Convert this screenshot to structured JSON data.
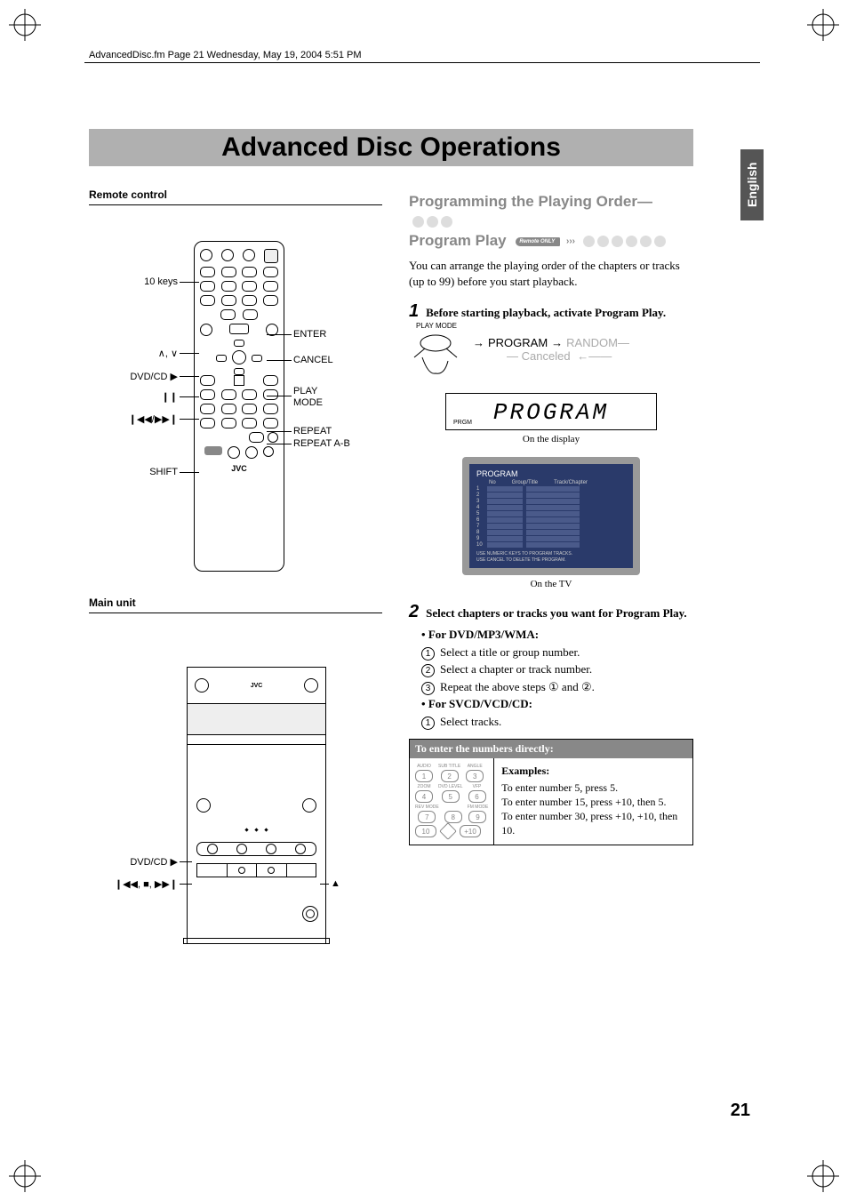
{
  "header_line": "AdvancedDisc.fm  Page 21  Wednesday, May 19, 2004  5:51 PM",
  "title": "Advanced Disc Operations",
  "lang_tab": "English",
  "page_number": "21",
  "left": {
    "remote_label": "Remote control",
    "main_unit_label": "Main unit",
    "remote_brand": "JVC",
    "labels": {
      "ten_keys": "10 keys",
      "cursor": "∧, ∨",
      "dvdcd": "DVD/CD ▶",
      "pause": "❙❙",
      "skip": "❙◀◀/▶▶❙",
      "shift": "SHIFT",
      "enter": "ENTER",
      "cancel": "CANCEL",
      "play_mode1": "PLAY",
      "play_mode2": "MODE",
      "repeat": "REPEAT",
      "repeat_ab": "REPEAT A-B"
    },
    "mu_labels": {
      "dvdcd": "DVD/CD ▶",
      "transport": "❙◀◀, ■, ▶▶❙",
      "eject": "▲"
    }
  },
  "right": {
    "section_line1": "Programming the Playing Order—",
    "section_line2": "Program Play",
    "remote_only": "Remote ONLY",
    "intro": "You can arrange the playing order of the chapters or tracks (up to 99) before you start playback.",
    "step1_num": "1",
    "step1_text": "Before starting playback, activate Program Play.",
    "mode_label": "PLAY MODE",
    "cycle_program": "PROGRAM",
    "cycle_random": "RANDOM",
    "cycle_canceled": "Canceled",
    "seg_text": "PROGRAM",
    "seg_prgm": "PRGM",
    "caption_display": "On the display",
    "caption_tv": "On the TV",
    "tv": {
      "title": "PROGRAM",
      "h1": "No",
      "h2": "Group/Title",
      "h3": "Track/Chapter",
      "foot1": "USE NUMERIC KEYS TO PROGRAM TRACKS.",
      "foot2": "USE CANCEL TO DELETE THE PROGRAM."
    },
    "step2_num": "2",
    "step2_text": "Select chapters or tracks you want for Program Play.",
    "for_dvd": "For DVD/MP3/WMA:",
    "s2a": "Select a title or group number.",
    "s2b": "Select a chapter or track number.",
    "s2c": "Repeat the above steps ① and ②.",
    "for_svcd": "For SVCD/VCD/CD:",
    "s2d": "Select tracks.",
    "enter_header": "To enter the numbers directly:",
    "keypad_labels": [
      "AUDIO",
      "SUB TITLE",
      "ANGLE",
      "ZOOM",
      "DVD LEVEL",
      "VFP",
      "REV MODE",
      "",
      "FM MODE"
    ],
    "keypad_nums": [
      "1",
      "2",
      "3",
      "4",
      "5",
      "6",
      "7",
      "8",
      "9",
      "10",
      "+10"
    ],
    "examples_head": "Examples:",
    "ex1": "To enter number 5, press 5.",
    "ex2": "To enter number 15, press +10, then 5.",
    "ex3": "To enter number 30, press +10, +10, then 10."
  }
}
